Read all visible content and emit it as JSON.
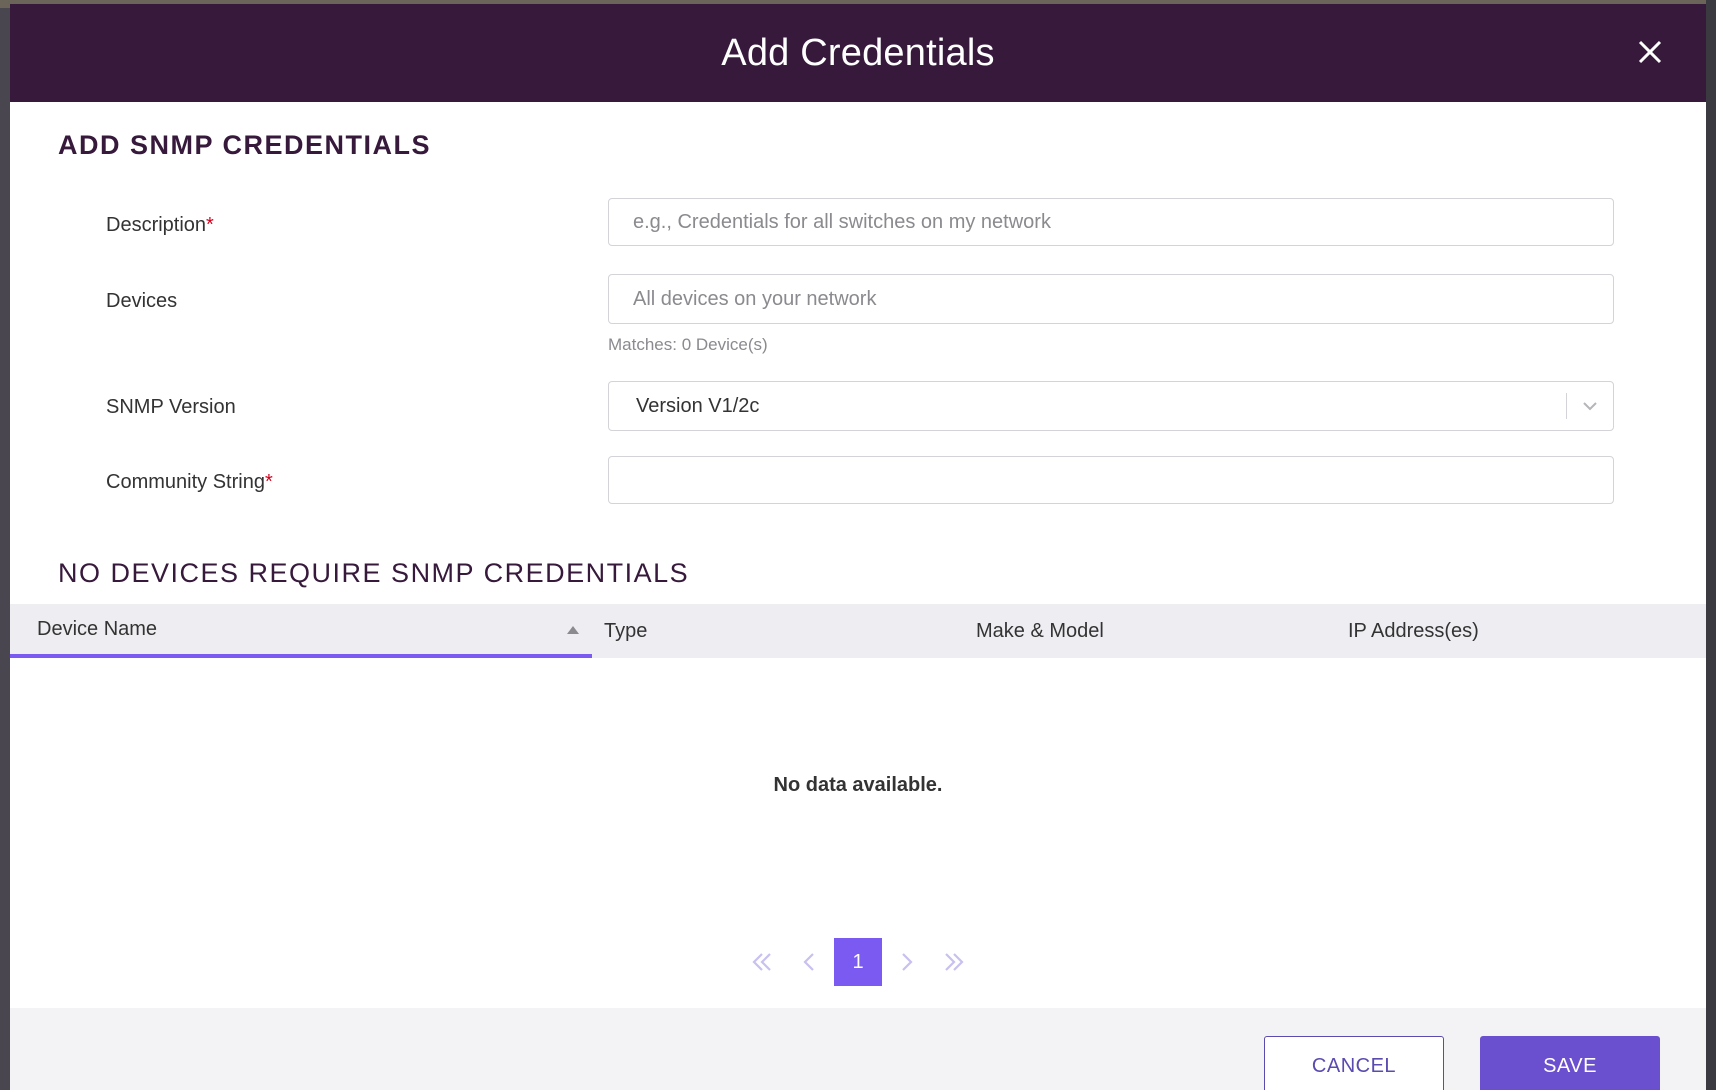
{
  "modal": {
    "title": "Add Credentials"
  },
  "form": {
    "section_title": "ADD SNMP CREDENTIALS",
    "required_marker": "*",
    "description": {
      "label": "Description",
      "value": "",
      "placeholder": "e.g., Credentials for all switches on my network"
    },
    "devices": {
      "label": "Devices",
      "value": "",
      "placeholder": "All devices on your network",
      "hint": "Matches: 0 Device(s)"
    },
    "snmp_version": {
      "label": "SNMP Version",
      "value": "Version V1/2c"
    },
    "community_string": {
      "label": "Community String",
      "value": ""
    }
  },
  "table": {
    "title": "NO DEVICES REQUIRE SNMP CREDENTIALS",
    "columns": [
      "Device Name",
      "Type",
      "Make & Model",
      "IP Address(es)"
    ],
    "sorted_column": "Device Name",
    "sort_direction": "ascending",
    "rows": [],
    "empty_message": "No data available."
  },
  "pagination": {
    "current_page": "1"
  },
  "footer": {
    "cancel_label": "CANCEL",
    "save_label": "SAVE"
  },
  "colors": {
    "header_bg": "#36193b",
    "accent": "#7a5af0",
    "save_bg": "#6a4fcf",
    "required": "#d0021b"
  },
  "icons": {
    "close": "close-icon",
    "dropdown": "chevron-down-icon",
    "sort": "sort-up-icon",
    "first": "double-chevron-left-icon",
    "prev": "chevron-left-icon",
    "next": "chevron-right-icon",
    "last": "double-chevron-right-icon"
  }
}
